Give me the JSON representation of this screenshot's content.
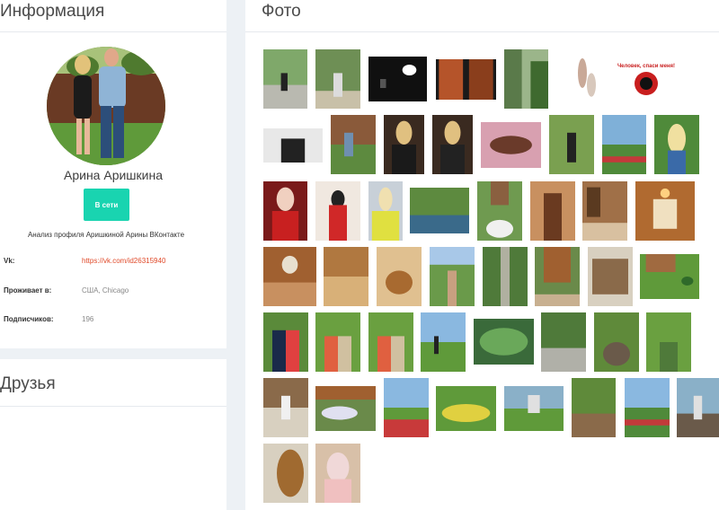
{
  "info": {
    "title": "Информация",
    "name": "Арина Аришкина",
    "online_label": "В сети",
    "caption": "Анализ профиля Аришкиной Арины ВКонтакте",
    "rows": [
      {
        "label": "Vk:",
        "value": "https://vk.com/id26315940"
      },
      {
        "label": "Проживает в:",
        "value": "США, Chicago"
      },
      {
        "label": "Подписчиков:",
        "value": "196"
      }
    ]
  },
  "friends": {
    "title": "Друзья"
  },
  "photos": {
    "title": "Фото",
    "thumb_texts": {
      "t7": "Человек, спаси меня!"
    }
  },
  "colors": {
    "accent": "#19d4b0",
    "link": "#e04a2a",
    "background": "#edf1f5"
  }
}
